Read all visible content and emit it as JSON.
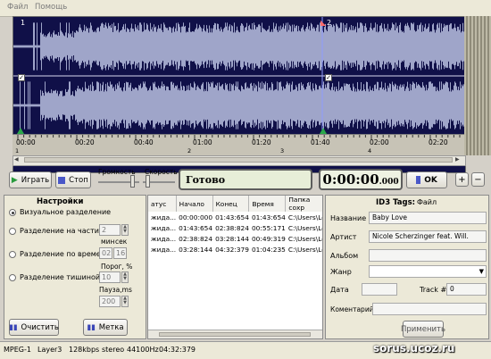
{
  "menu": {
    "file": "Файл",
    "help": "Помощь"
  },
  "wave": {
    "marker_1": "1",
    "marker_2": "2",
    "ticks": [
      "00:00",
      "00:20",
      "00:40",
      "01:00",
      "01:20",
      "01:40",
      "02:00",
      "02:20"
    ],
    "segments": [
      "1",
      "2",
      "3",
      "4"
    ]
  },
  "toolbar": {
    "play": "Играть",
    "stop": "Стоп",
    "volume": "Громкость",
    "speed": "Скорость",
    "status": "Готово",
    "time_main": "0:00:00",
    "time_ms": ".000",
    "ok": "OK",
    "plus": "+",
    "minus": "−"
  },
  "settings": {
    "title": "Настройки",
    "visual": "Визуальное разделение",
    "parts": "Разделение на части",
    "parts_value": "2",
    "min": "мин",
    "sec": "сек",
    "time_split": "Разделение по времени",
    "min_value": "02",
    "sec_value": "16",
    "threshold": "Порог, %",
    "silence": "Разделение тишиной",
    "threshold_value": "10",
    "pause": "Пауза,ms",
    "pause_value": "200",
    "clear": "Очистить",
    "mark": "Метка"
  },
  "table": {
    "headers": [
      "атус",
      "Начало",
      "Конец",
      "Время",
      "Папка сохр"
    ],
    "rows": [
      [
        "жида...",
        "00:00:000",
        "01:43:654",
        "01:43:654",
        "C:\\Users\\Le"
      ],
      [
        "жида...",
        "01:43:654",
        "02:38:824",
        "00:55:171",
        "C:\\Users\\Le"
      ],
      [
        "жида...",
        "02:38:824",
        "03:28:144",
        "00:49:319",
        "C:\\Users\\Le"
      ],
      [
        "жида...",
        "03:28:144",
        "04:32:379",
        "01:04:235",
        "C:\\Users\\Le"
      ]
    ]
  },
  "id3": {
    "title": "ID3 Tags:",
    "file": "Файл",
    "name_label": "Название",
    "name_value": "Baby Love",
    "artist_label": "Артист",
    "artist_value": "Nicole Scherzinger feat. Will.",
    "album_label": "Альбом",
    "album_value": "",
    "genre_label": "Жанр",
    "genre_value": "",
    "date_label": "Дата",
    "date_value": "",
    "track_label": "Track #",
    "track_value": "0",
    "comment_label": "Коментарий",
    "comment_value": "",
    "apply": "Применить"
  },
  "statusbar": {
    "format": "MPEG-1",
    "layer": "Layer3",
    "bitrate": "128kbps",
    "mode": "stereo",
    "rate": "44100Hz",
    "duration": "04:32:379",
    "watermark": "sorus.ucoz.ru"
  },
  "colors": {
    "wave_bg": "#101048",
    "wave": "#b9bfe0",
    "marker": "#2aa84a"
  }
}
